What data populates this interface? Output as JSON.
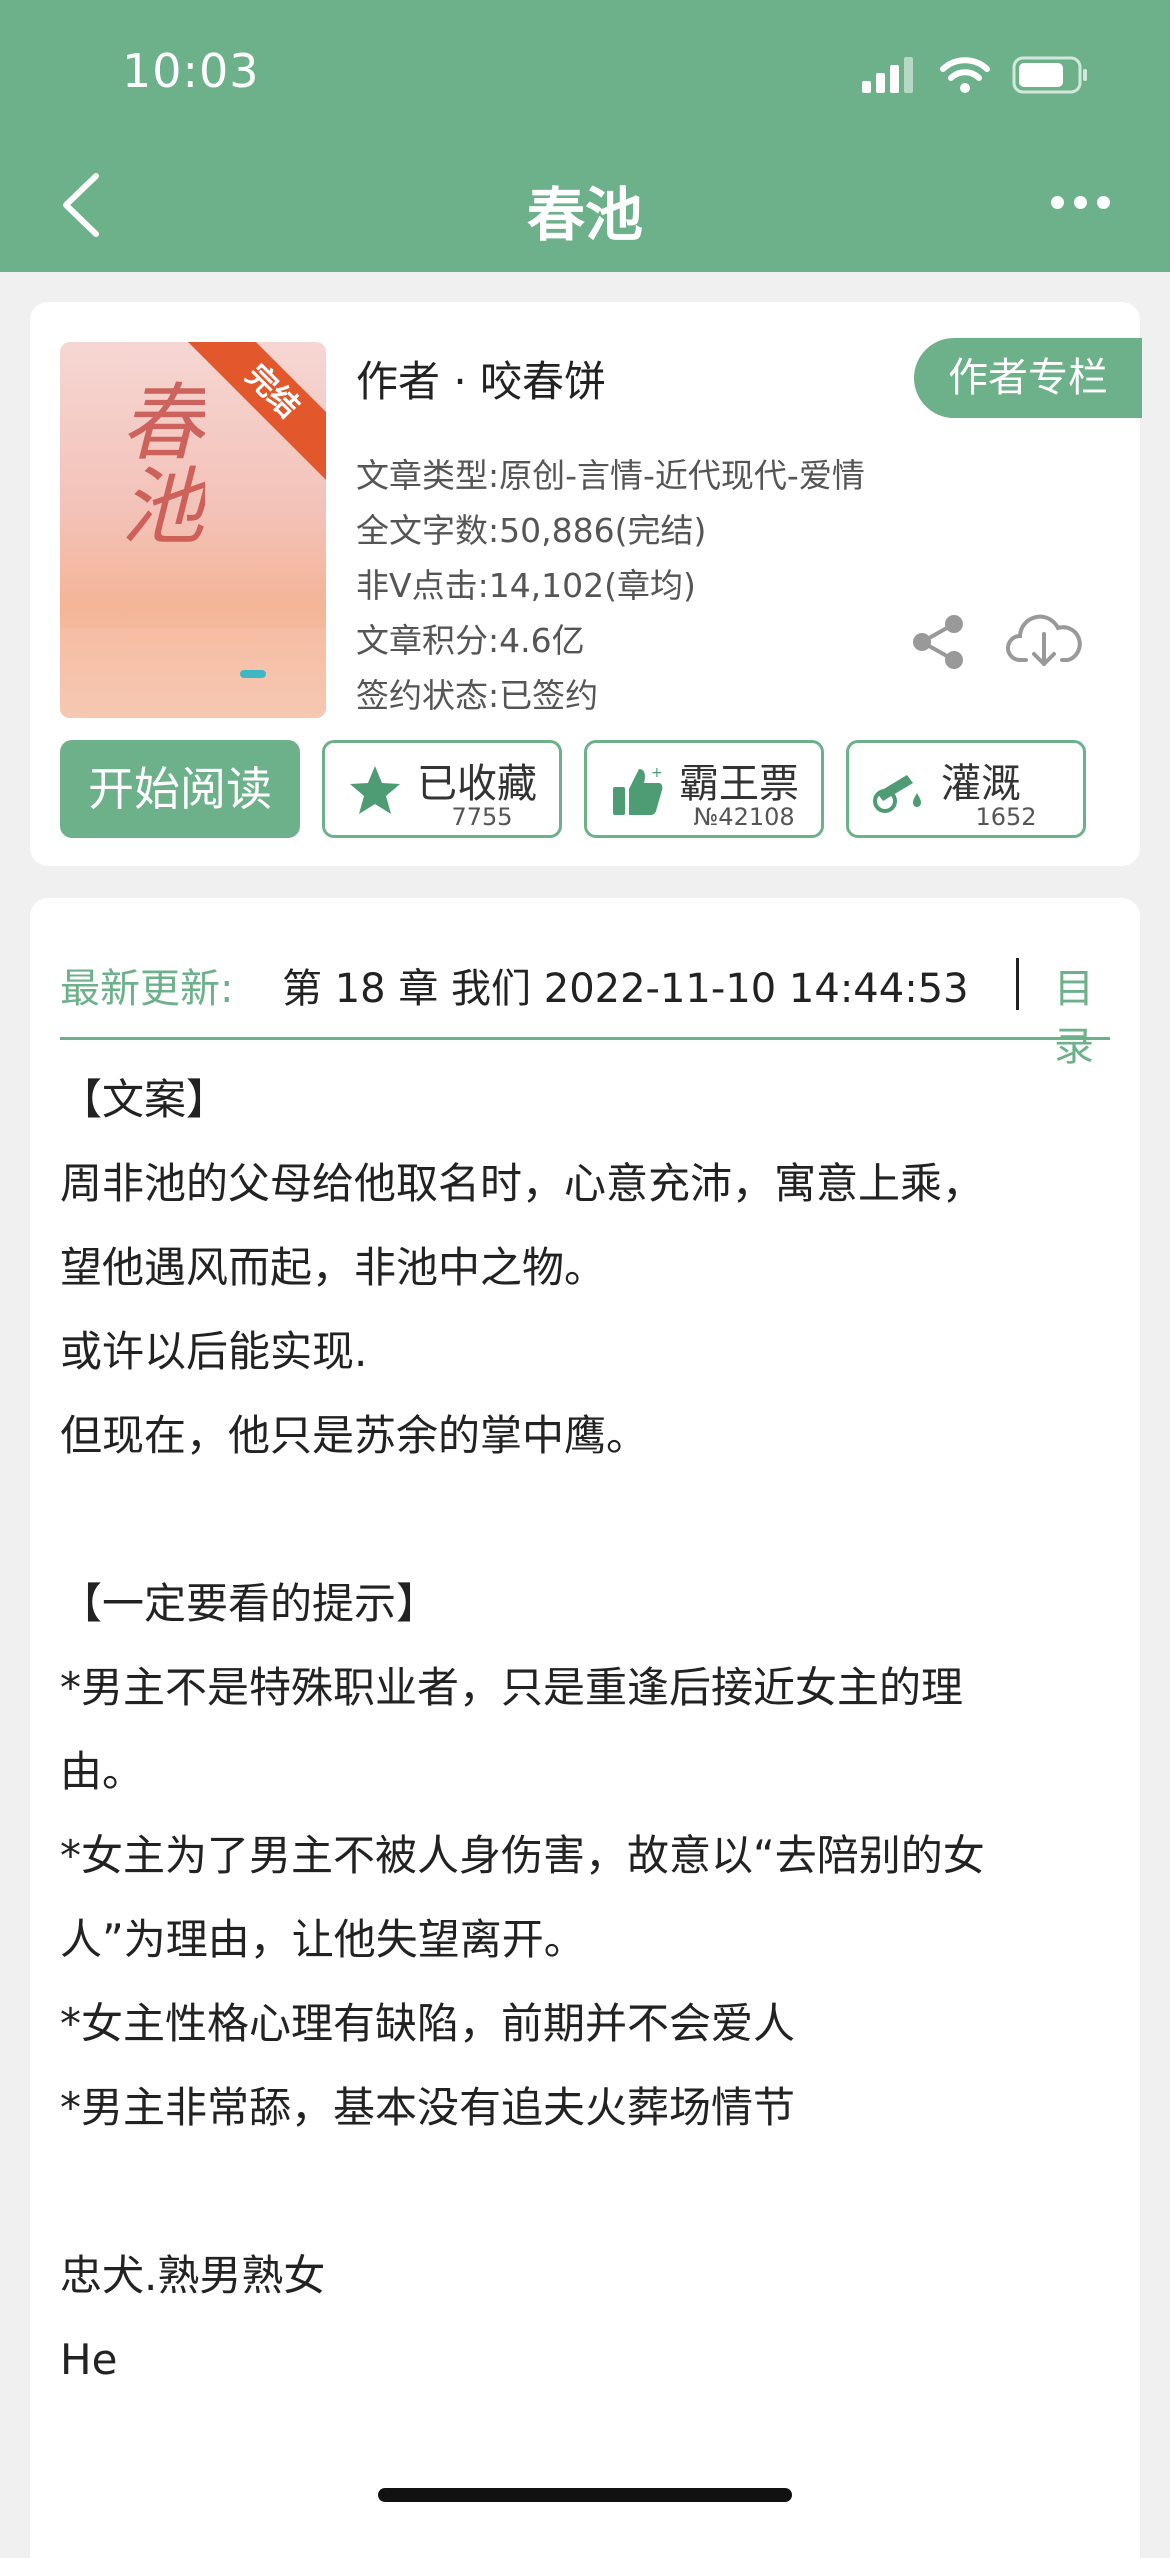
{
  "status_bar": {
    "time": "10:03"
  },
  "nav": {
    "title": "春池"
  },
  "book": {
    "badge": "完结",
    "cover_title": "春池",
    "author_line": "作者 · 咬春饼",
    "author_column_button": "作者专栏",
    "meta": [
      "文章类型:原创-言情-近代现代-爱情",
      "全文字数:50,886(完结)",
      "非V点击:14,102(章均)",
      "文章积分:4.6亿",
      "签约状态:已签约"
    ]
  },
  "actions": {
    "read_label": "开始阅读",
    "collect": {
      "label": "已收藏",
      "count": "7755"
    },
    "vote": {
      "label": "霸王票",
      "count": "№42108"
    },
    "water": {
      "label": "灌溉",
      "count": "1652"
    }
  },
  "update": {
    "label": "最新更新:",
    "text": "第 18 章 我们 2022-11-10 14:44:53",
    "toc_label": "目录"
  },
  "synopsis": [
    "【文案】",
    "周非池的父母给他取名时，心意充沛，寓意上乘，",
    "望他遇风而起，非池中之物。",
    "或许以后能实现.",
    "但现在，他只是苏余的掌中鹰。",
    "",
    "【一定要看的提示】",
    "*男主不是特殊职业者，只是重逢后接近女主的理",
    "由。",
    "*女主为了男主不被人身伤害，故意以“去陪别的女",
    "人”为理由，让他失望离开。",
    "*女主性格心理有缺陷，前期并不会爱人",
    "*男主非常舔，基本没有追夫火葬场情节",
    "",
    "忠犬.熟男熟女",
    "He"
  ],
  "theme": {
    "accent": "#6db18b",
    "badge": "#e2572b"
  }
}
